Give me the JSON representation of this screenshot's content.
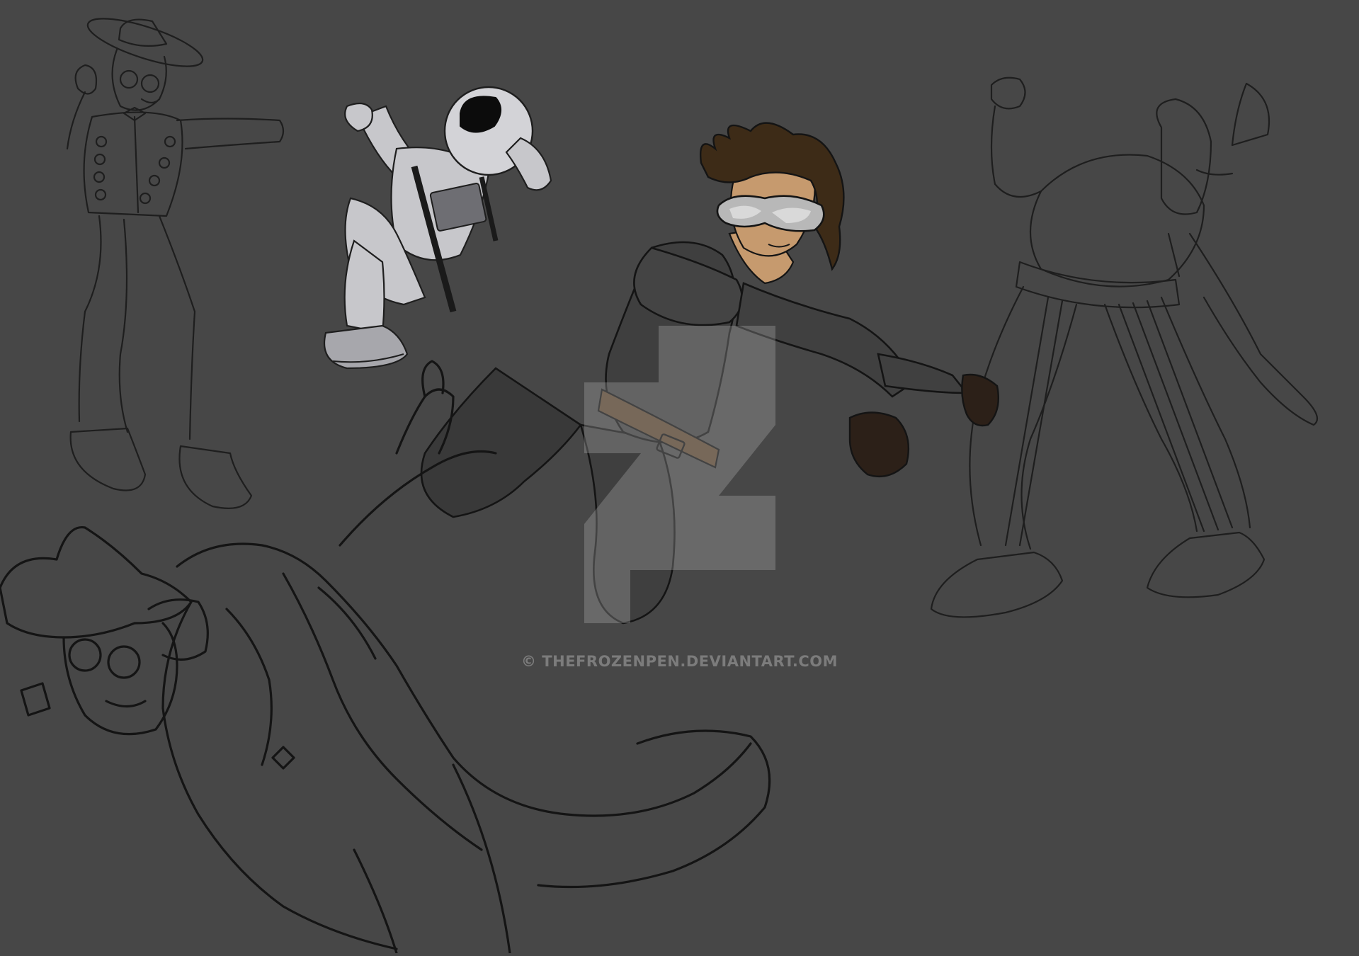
{
  "artwork": {
    "background_color": "#474747",
    "figures": [
      {
        "name": "boater-hat-man-sketch",
        "style": "line-art"
      },
      {
        "name": "astronaut",
        "style": "greyscale-flat"
      },
      {
        "name": "goggled-hero",
        "style": "colored",
        "colors": {
          "hair": "#3d2b17",
          "skin": "#c69a6e",
          "gloves": "#2c2018",
          "suit": "#3f3f3f",
          "goggles": "#b8b8b8"
        }
      },
      {
        "name": "striped-pants-brawler-sketch",
        "style": "line-art"
      },
      {
        "name": "hat-woman-foreground-sketch",
        "style": "line-art"
      }
    ],
    "watermark": {
      "logo": "deviantart-logo-icon",
      "text": "© THEFROZENPEN.DEVIANTART.COM"
    }
  }
}
